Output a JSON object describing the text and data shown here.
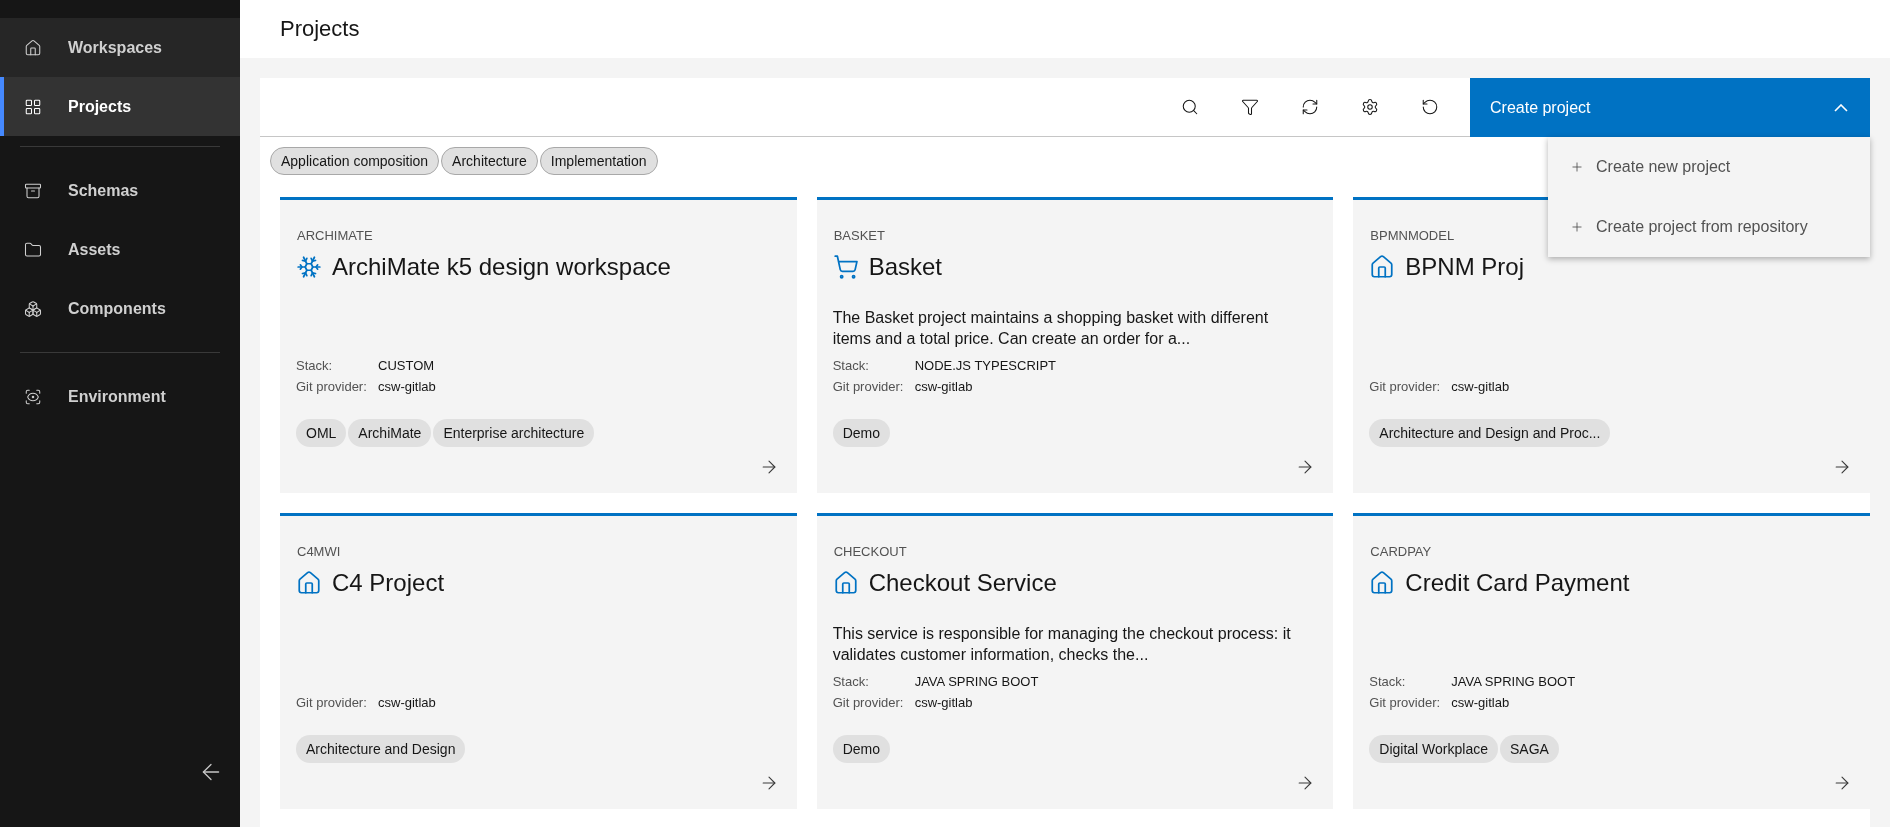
{
  "sidebar": {
    "groups": [
      [
        {
          "label": "Workspaces",
          "selected": false
        },
        {
          "label": "Projects",
          "selected": true
        }
      ],
      [
        {
          "label": "Schemas",
          "selected": false
        },
        {
          "label": "Assets",
          "selected": false
        },
        {
          "label": "Components",
          "selected": false
        }
      ],
      [
        {
          "label": "Environment",
          "selected": false
        }
      ]
    ]
  },
  "page_title": "Projects",
  "toolbar": {
    "create_button": {
      "label": "Create project",
      "expanded": true
    },
    "menu": [
      "Create new project",
      "Create project from repository"
    ]
  },
  "filter_chips": [
    "Application composition",
    "Architecture",
    "Implementation"
  ],
  "cards": [
    {
      "category": "ARCHIMATE",
      "title": "ArchiMate k5 design workspace",
      "meta": [
        {
          "label": "Stack:",
          "value": "CUSTOM"
        },
        {
          "label": "Git provider:",
          "value": "csw-gitlab"
        }
      ],
      "tags": [
        "OML",
        "ArchiMate",
        "Enterprise architecture"
      ]
    },
    {
      "category": "BASKET",
      "title": "Basket",
      "description": "The Basket project maintains a shopping basket with different items and a total price. Can create an order for a...",
      "meta": [
        {
          "label": "Stack:",
          "value": "NODE.JS TYPESCRIPT"
        },
        {
          "label": "Git provider:",
          "value": "csw-gitlab"
        }
      ],
      "tags": [
        "Demo"
      ]
    },
    {
      "category": "BPMNMODEL",
      "title": "BPNM Proj",
      "meta": [
        {
          "label": "Git provider:",
          "value": "csw-gitlab"
        }
      ],
      "tags": [
        "Architecture and Design and Proc..."
      ]
    },
    {
      "category": "C4MWI",
      "title": "C4 Project",
      "meta": [
        {
          "label": "Git provider:",
          "value": "csw-gitlab"
        }
      ],
      "tags": [
        "Architecture and Design"
      ]
    },
    {
      "category": "CHECKOUT",
      "title": "Checkout Service",
      "description": "This service is responsible for managing the checkout process: it validates customer information, checks the...",
      "meta": [
        {
          "label": "Stack:",
          "value": "JAVA SPRING BOOT"
        },
        {
          "label": "Git provider:",
          "value": "csw-gitlab"
        }
      ],
      "tags": [
        "Demo"
      ]
    },
    {
      "category": "CARDPAY",
      "title": "Credit Card Payment",
      "meta": [
        {
          "label": "Stack:",
          "value": "JAVA SPRING BOOT"
        },
        {
          "label": "Git provider:",
          "value": "csw-gitlab"
        }
      ],
      "tags": [
        "Digital Workplace",
        "SAGA"
      ]
    }
  ]
}
